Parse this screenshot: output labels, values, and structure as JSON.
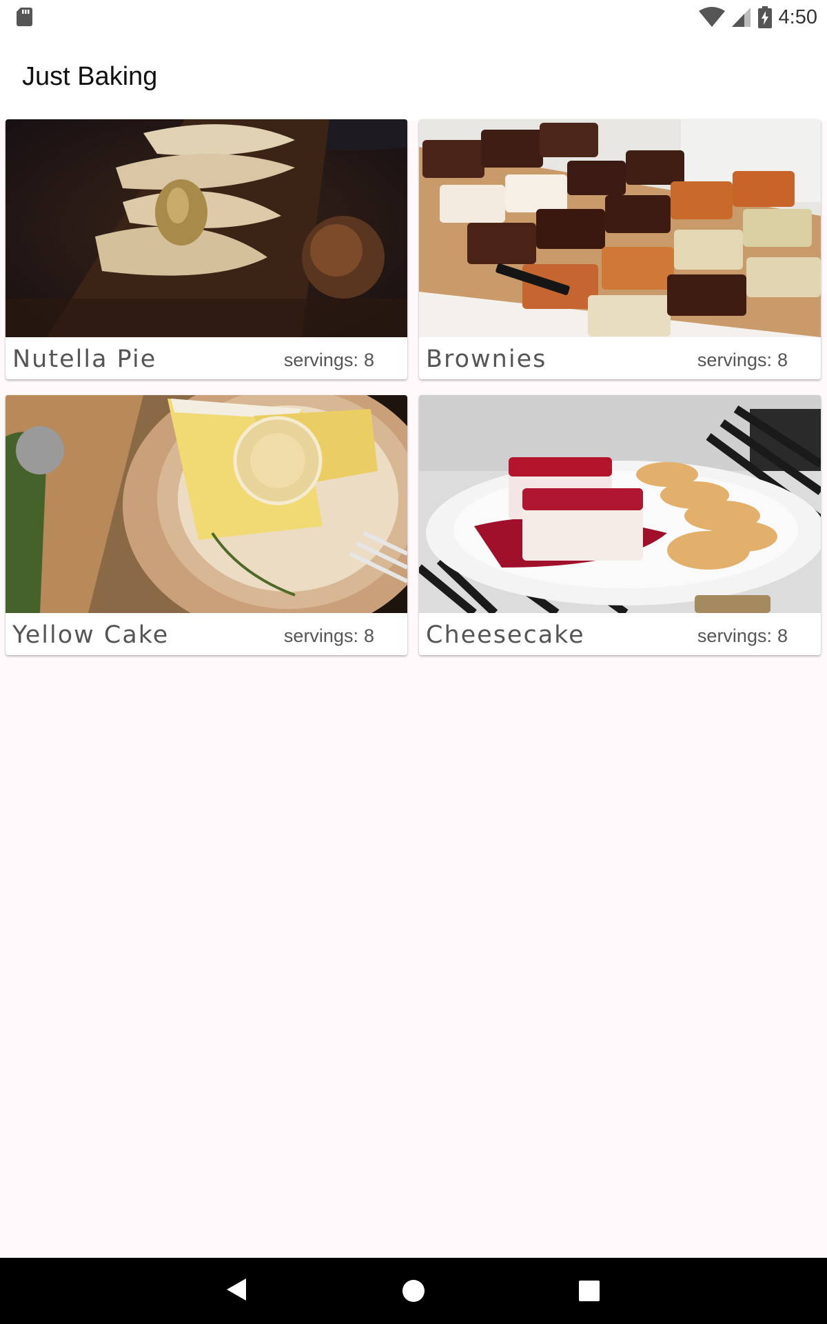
{
  "status_bar": {
    "time": "4:50",
    "icons": [
      "sd-card-icon",
      "wifi-icon",
      "signal-icon",
      "battery-charging-icon"
    ]
  },
  "app": {
    "title": "Just Baking"
  },
  "recipes": [
    {
      "name": "Nutella Pie",
      "servings_label": "servings:",
      "servings": "8",
      "image": "nutella-pie-photo"
    },
    {
      "name": "Brownies",
      "servings_label": "servings:",
      "servings": "8",
      "image": "brownies-photo"
    },
    {
      "name": "Yellow Cake",
      "servings_label": "servings:",
      "servings": "8",
      "image": "yellow-cake-photo"
    },
    {
      "name": "Cheesecake",
      "servings_label": "servings:",
      "servings": "8",
      "image": "cheesecake-photo"
    }
  ],
  "nav_bar": {
    "icons": [
      "back-icon",
      "home-icon",
      "recent-apps-icon"
    ]
  },
  "colors": {
    "background": "#fff9fc",
    "toolbar": "#ffffff",
    "text_primary": "#111111",
    "text_secondary": "#555555",
    "nav_bar": "#000000"
  }
}
